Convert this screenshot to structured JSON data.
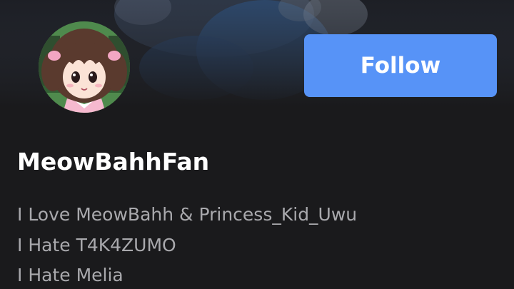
{
  "profile": {
    "username": "MeowBahhFan",
    "follow_label": "Follow",
    "bio_lines": [
      "I Love MeowBahh & Princess_Kid_Uwu",
      "I Hate T4K4ZUMO",
      "I Hate Melia"
    ]
  },
  "colors": {
    "background": "#1a1a1c",
    "accent": "#5793f7",
    "username_text": "#ffffff",
    "bio_text": "#a9a9ad"
  },
  "icons": {
    "avatar": "anime-girl-avatar"
  }
}
